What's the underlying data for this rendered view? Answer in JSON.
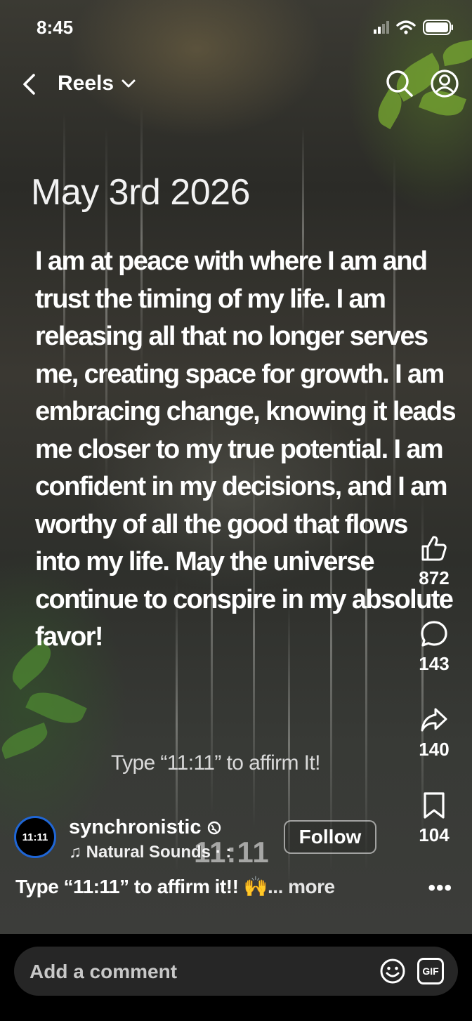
{
  "status_bar": {
    "time": "8:45"
  },
  "header": {
    "title": "Reels"
  },
  "reel": {
    "date": "May 3rd 2026",
    "affirmation": "I am at peace with where I am and trust the timing of my life. I am releasing all that no longer serves me, creating space for growth. I am embracing change, knowing it leads me closer to my true potential. I am confident in my decisions, and I am worthy of all the good that flows into my life. May the universe continue to conspire in my absolute favor!",
    "affirm_prompt": "Type “11:11” to affirm It!",
    "overlay_timer": "11:11"
  },
  "actions": {
    "likes": "872",
    "comments": "143",
    "shares": "140",
    "saves": "104"
  },
  "author": {
    "avatar_text": "11:11",
    "username": "synchronistic",
    "music": "♫ Natural Sounds · :",
    "follow_label": "Follow"
  },
  "caption": {
    "text": "Type “11:11” to affirm it!! 🙌",
    "more": "... more",
    "options": "•••"
  },
  "comment": {
    "placeholder": "Add a comment",
    "gif_label": "GIF"
  },
  "icons": {
    "back": "chevron-left-icon",
    "dropdown": "chevron-down-icon",
    "search": "search-icon",
    "profile": "profile-icon",
    "like": "thumbs-up-icon",
    "comment": "comment-icon",
    "share": "share-icon",
    "save": "bookmark-icon",
    "emoji": "emoji-icon",
    "globe": "globe-icon"
  }
}
